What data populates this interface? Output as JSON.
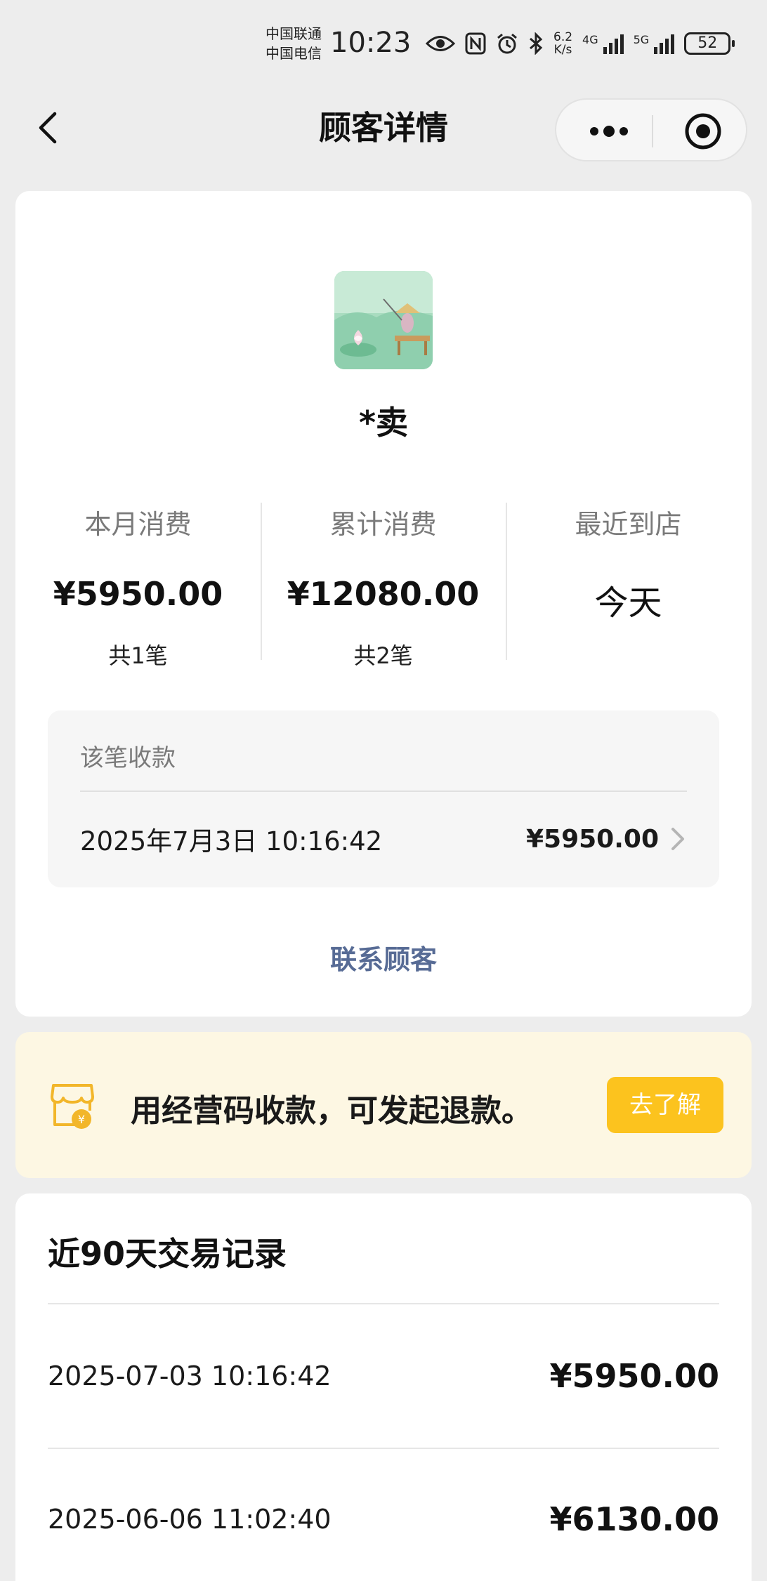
{
  "status_bar": {
    "carrier1": "中国联通",
    "carrier2": "中国电信",
    "time": "10:23",
    "net_speed_value": "6.2",
    "net_speed_unit": "K/s",
    "sig1_label": "4G",
    "sig2_label": "5G",
    "battery": "52"
  },
  "nav": {
    "title": "顾客详情"
  },
  "customer": {
    "name": "*卖"
  },
  "stats": [
    {
      "label": "本月消费",
      "value": "¥5950.00",
      "count": "共1笔"
    },
    {
      "label": "累计消费",
      "value": "¥12080.00",
      "count": "共2笔"
    },
    {
      "label": "最近到店",
      "value": "今天"
    }
  ],
  "payment": {
    "title": "该笔收款",
    "datetime": "2025年7月3日 10:16:42",
    "amount": "¥5950.00"
  },
  "contact_label": "联系顾客",
  "banner": {
    "text": "用经营码收款，可发起退款。",
    "button": "去了解"
  },
  "records": {
    "title": "近90天交易记录",
    "items": [
      {
        "time": "2025-07-03 10:16:42",
        "amount": "¥5950.00"
      },
      {
        "time": "2025-06-06 11:02:40",
        "amount": "¥6130.00"
      }
    ]
  },
  "colors": {
    "link": "#576b95",
    "accent_button": "#fcc31e",
    "banner_bg": "#fdf7e3",
    "page_bg": "#ededed"
  },
  "icons": [
    "eye-icon",
    "nfc-icon",
    "alarm-icon",
    "bluetooth-icon",
    "back-arrow-icon",
    "more-icon",
    "target-icon",
    "chevron-right-icon",
    "shop-payment-icon"
  ]
}
